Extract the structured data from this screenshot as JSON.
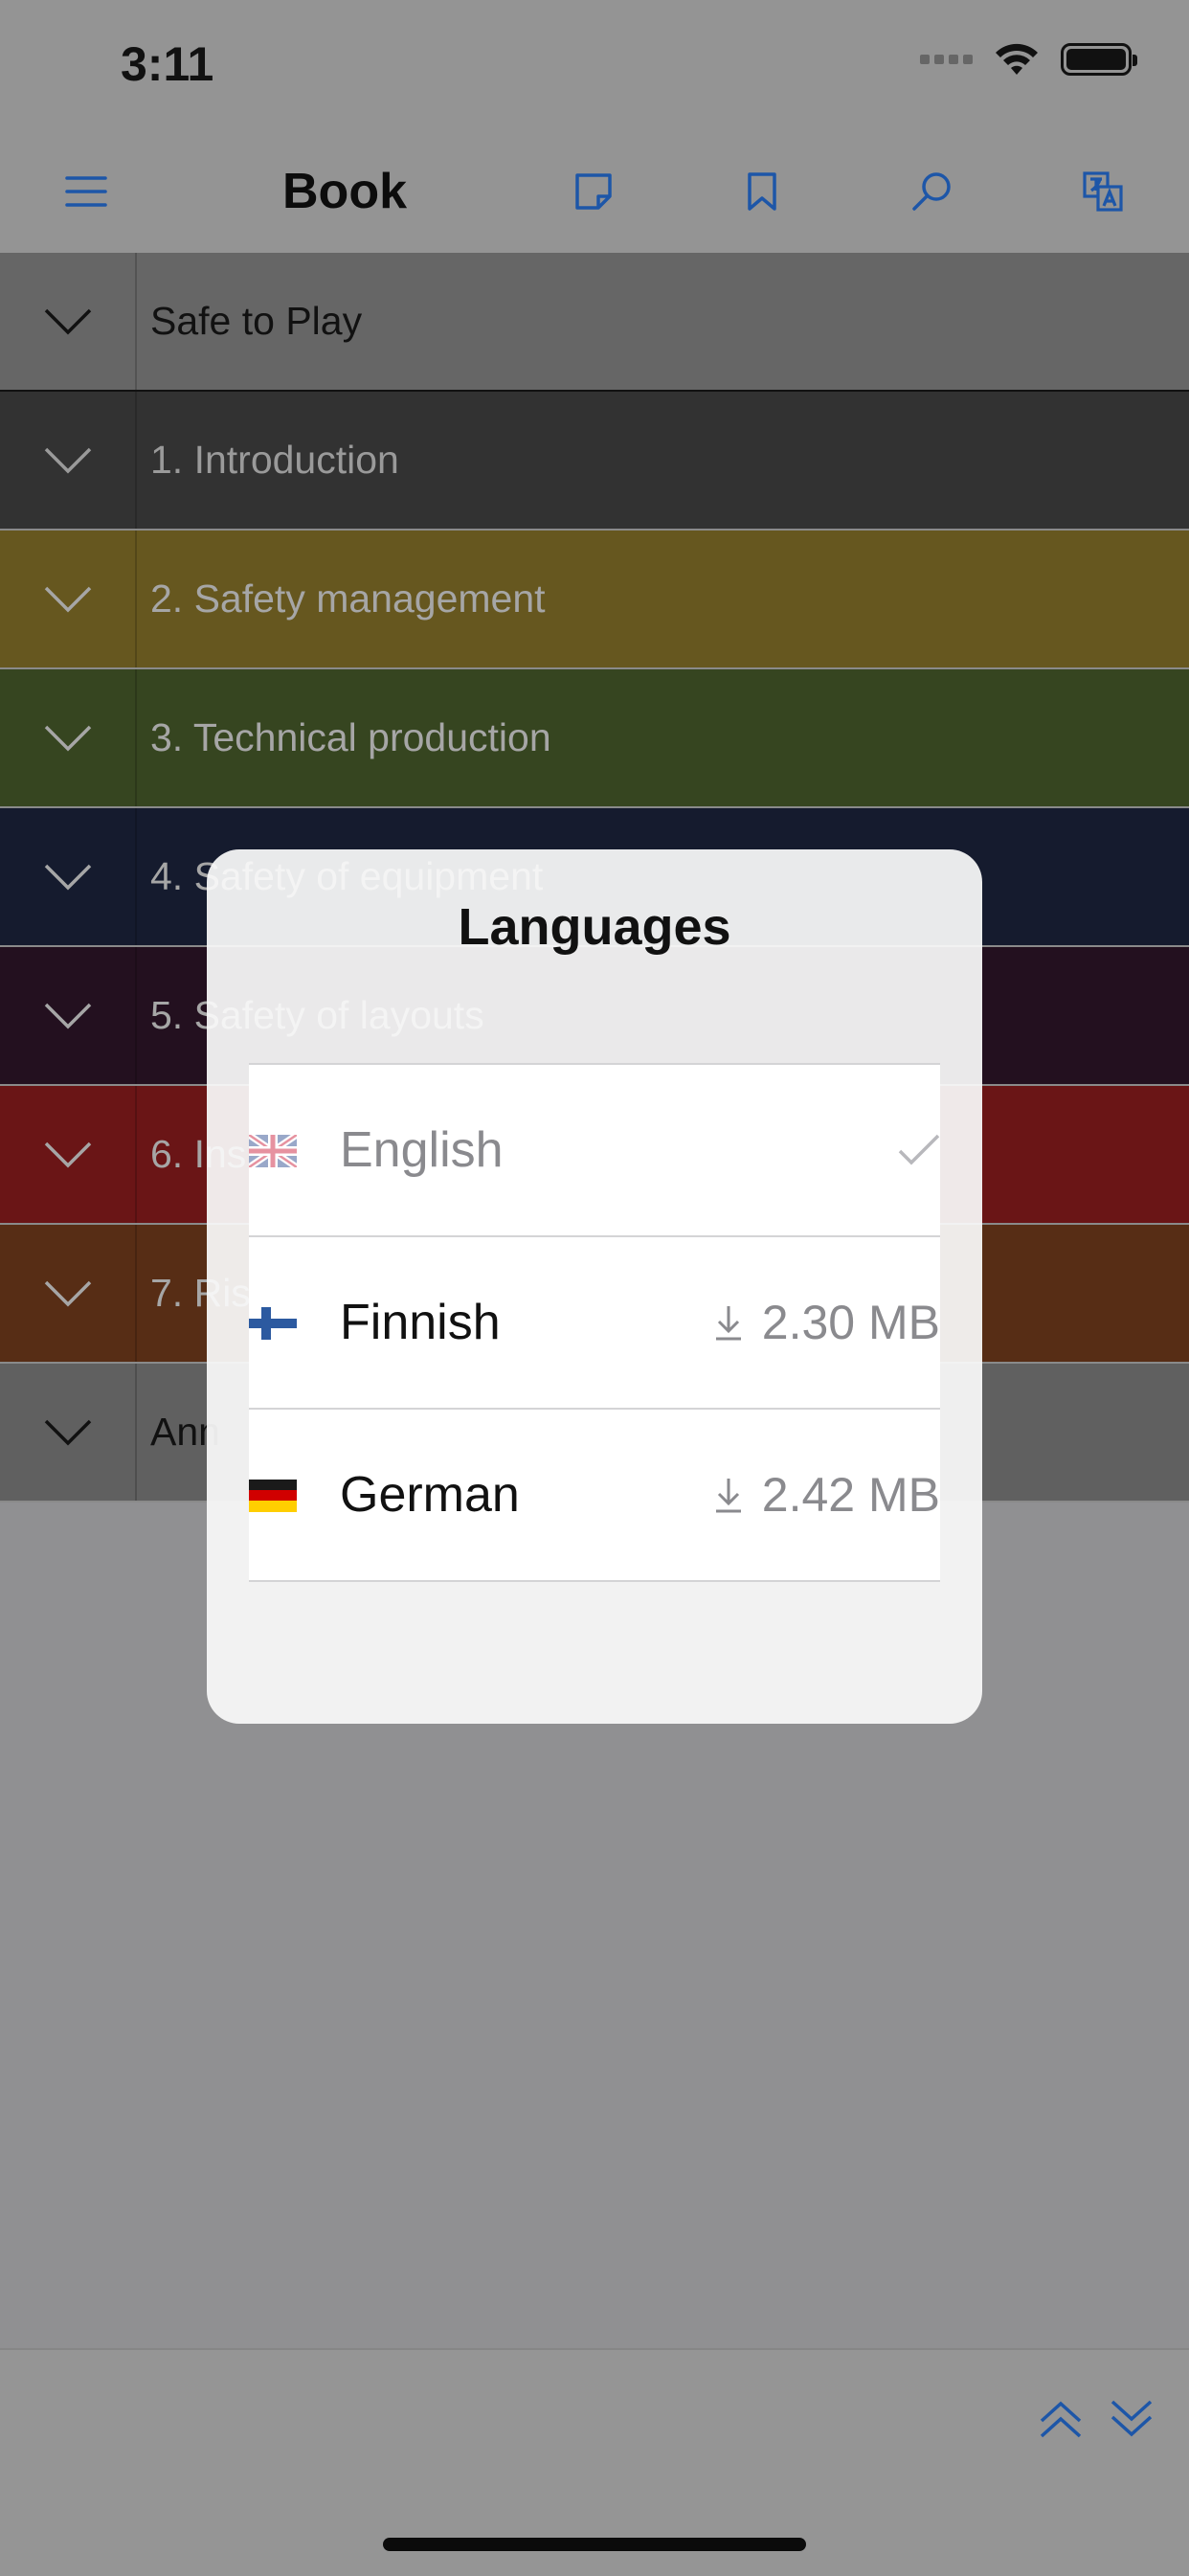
{
  "status": {
    "time": "3:11"
  },
  "nav": {
    "title": "Book",
    "icons": [
      "menu-icon",
      "note-icon",
      "bookmark-icon",
      "search-icon",
      "translate-icon"
    ],
    "accent": "#1d56a8"
  },
  "toc": {
    "items": [
      {
        "label": "Safe to Play",
        "color": "#666666",
        "text_color": "#111111"
      },
      {
        "label": "1. Introduction",
        "color": "#323232",
        "text_color": "#9a9a9a"
      },
      {
        "label": "2. Safety management",
        "color": "#66571f",
        "text_color": "#a6a6a6"
      },
      {
        "label": "3. Technical production",
        "color": "#364520",
        "text_color": "#a6a6a6"
      },
      {
        "label": "4. Safety of equipment",
        "color": "#151b2e",
        "text_color": "#a6a6a6"
      },
      {
        "label": "5. Safety of layouts",
        "color": "#23101f",
        "text_color": "#a6a6a6"
      },
      {
        "label": "6. Ins",
        "color": "#6a1516",
        "text_color": "#a6a6a6"
      },
      {
        "label": "7. Ris",
        "color": "#572d15",
        "text_color": "#a6a6a6"
      },
      {
        "label": "Ann",
        "color": "#606060",
        "text_color": "#111111"
      }
    ]
  },
  "dialog": {
    "title": "Languages",
    "languages": [
      {
        "name": "English",
        "status": "selected",
        "size": "",
        "flag": "uk-flag-icon"
      },
      {
        "name": "Finnish",
        "status": "download",
        "size": "2.30 MB",
        "flag": "finland-flag-icon"
      },
      {
        "name": "German",
        "status": "download",
        "size": "2.42 MB",
        "flag": "germany-flag-icon"
      }
    ]
  },
  "bottom_bar": {
    "icons": [
      "double-chevron-up-icon",
      "double-chevron-down-icon"
    ]
  }
}
